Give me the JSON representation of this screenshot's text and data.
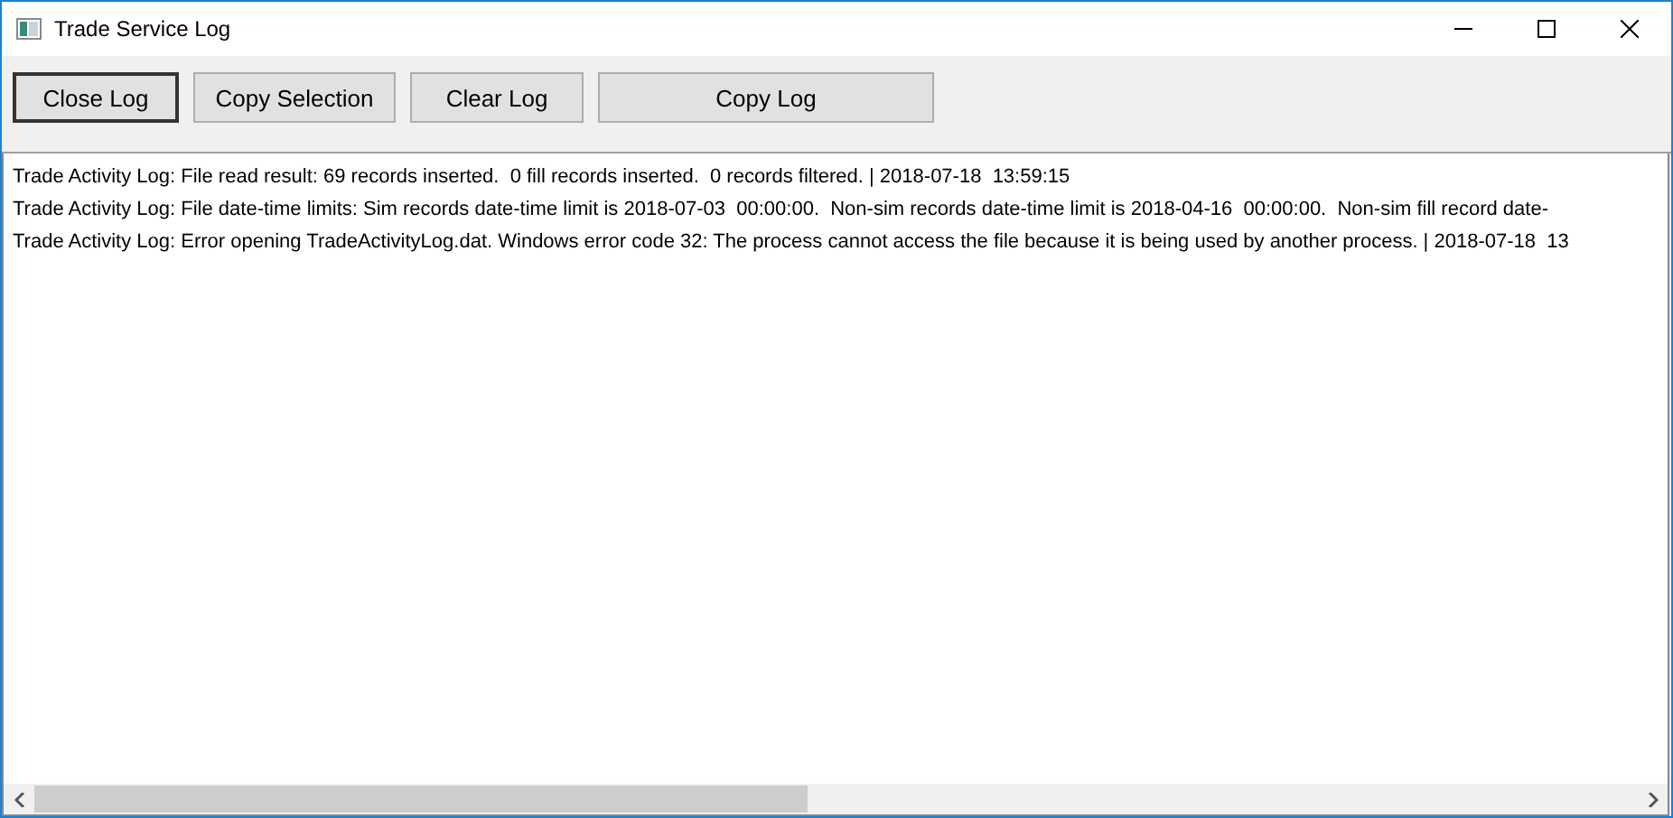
{
  "window": {
    "title": "Trade Service Log"
  },
  "buttons": [
    {
      "label": "Close Log",
      "default": true
    },
    {
      "label": "Copy Selection",
      "default": false
    },
    {
      "label": "Clear Log",
      "default": false
    },
    {
      "label": "Copy Log",
      "default": false
    }
  ],
  "log_lines": [
    "Trade Activity Log: File read result: 69 records inserted.  0 fill records inserted.  0 records filtered. | 2018-07-18  13:59:15",
    "Trade Activity Log: File date-time limits: Sim records date-time limit is 2018-07-03  00:00:00.  Non-sim records date-time limit is 2018-04-16  00:00:00.  Non-sim fill record date-",
    "Trade Activity Log: Error opening TradeActivityLog.dat. Windows error code 32: The process cannot access the file because it is being used by another process. | 2018-07-18  13"
  ]
}
